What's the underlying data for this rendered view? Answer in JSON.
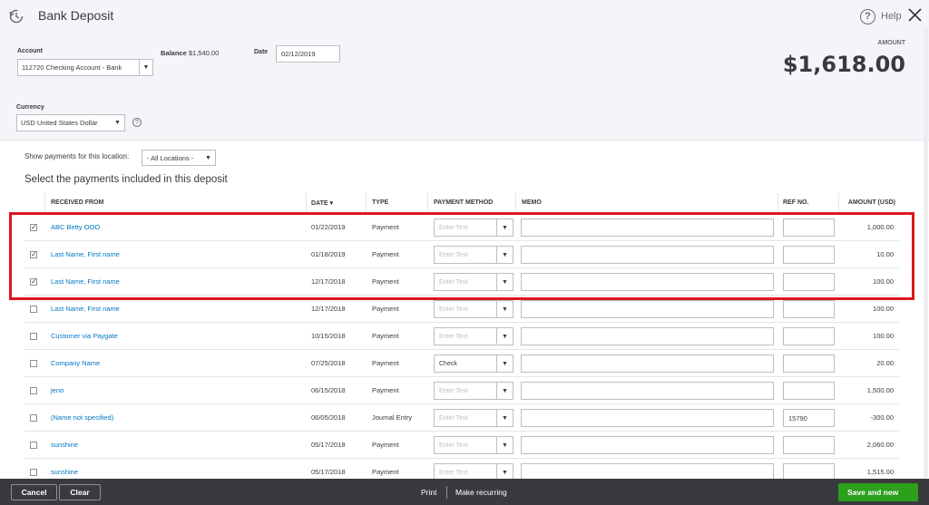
{
  "header": {
    "title": "Bank Deposit",
    "help_label": "Help",
    "history_icon": "history-clock-icon",
    "close_icon": "close-icon"
  },
  "account": {
    "label": "Account",
    "value": "112720 Checking Account - Bank",
    "balance_label": "Balance",
    "balance_value": "$1,540.00"
  },
  "date": {
    "label": "Date",
    "value": "02/12/2019"
  },
  "amount": {
    "label": "AMOUNT",
    "value": "$1,618.00"
  },
  "currency": {
    "label": "Currency",
    "value": "USD United States Dollar"
  },
  "location": {
    "label": "Show payments for this location:",
    "value": "- All Locations -"
  },
  "section_title": "Select the payments included in this deposit",
  "table": {
    "columns": {
      "received_from": "RECEIVED FROM",
      "date": "DATE ▾",
      "type": "TYPE",
      "payment_method": "PAYMENT METHOD",
      "memo": "MEMO",
      "ref_no": "REF NO.",
      "amount": "AMOUNT (USD)"
    },
    "placeholder": "Enter Text",
    "rows": [
      {
        "checked": true,
        "received_from": "ABC Betty OOO",
        "date": "01/22/2019",
        "type": "Payment",
        "payment_method": "",
        "ref_no": "",
        "amount": "1,000.00"
      },
      {
        "checked": true,
        "received_from": "Last Name, First name",
        "date": "01/18/2019",
        "type": "Payment",
        "payment_method": "",
        "ref_no": "",
        "amount": "10.00"
      },
      {
        "checked": true,
        "received_from": "Last Name, First name",
        "date": "12/17/2018",
        "type": "Payment",
        "payment_method": "",
        "ref_no": "",
        "amount": "100.00"
      },
      {
        "checked": false,
        "received_from": "Last Name, First name",
        "date": "12/17/2018",
        "type": "Payment",
        "payment_method": "",
        "ref_no": "",
        "amount": "100.00"
      },
      {
        "checked": false,
        "received_from": "Customer via Paygate",
        "date": "10/15/2018",
        "type": "Payment",
        "payment_method": "",
        "ref_no": "",
        "amount": "100.00"
      },
      {
        "checked": false,
        "received_from": "Company Name",
        "date": "07/25/2018",
        "type": "Payment",
        "payment_method": "Check",
        "ref_no": "",
        "amount": "20.00"
      },
      {
        "checked": false,
        "received_from": "jeno",
        "date": "06/15/2018",
        "type": "Payment",
        "payment_method": "",
        "ref_no": "",
        "amount": "1,500.00"
      },
      {
        "checked": false,
        "received_from": "(Name not specified)",
        "date": "06/05/2018",
        "type": "Journal Entry",
        "payment_method": "",
        "ref_no": "15790",
        "amount": "-300.00"
      },
      {
        "checked": false,
        "received_from": "sunshine",
        "date": "05/17/2018",
        "type": "Payment",
        "payment_method": "",
        "ref_no": "",
        "amount": "2,060.00"
      },
      {
        "checked": false,
        "received_from": "sunshine",
        "date": "05/17/2018",
        "type": "Payment",
        "payment_method": "",
        "ref_no": "",
        "amount": "1,515.00"
      }
    ]
  },
  "footer": {
    "cancel": "Cancel",
    "clear": "Clear",
    "print": "Print",
    "make_recurring": "Make recurring",
    "save_and_new": "Save and new"
  },
  "colors": {
    "link": "#0077c5",
    "highlight": "#e0161d",
    "save": "#2ca01c",
    "footer": "#393a3d"
  }
}
